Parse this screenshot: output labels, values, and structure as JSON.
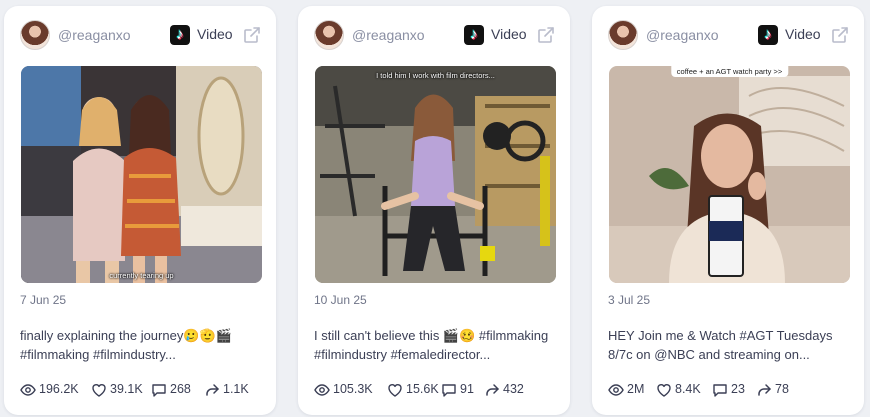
{
  "cards": [
    {
      "username": "@reaganxo",
      "post_type": "Video",
      "thumbnail_caption": "currently tearing up",
      "date": "7 Jun 25",
      "description_lines": [
        "finally explaining the journey🥲🫡🎬",
        "#filmmaking #filmindustry..."
      ],
      "views": "196.2K",
      "likes": "39.1K",
      "comments": "268",
      "shares": "1.1K"
    },
    {
      "username": "@reaganxo",
      "post_type": "Video",
      "thumbnail_caption": "I told him I work with film directors...",
      "date": "10 Jun 25",
      "description_lines": [
        "I still can't believe this 🎬🥴 #filmmaking",
        "#filmindustry #femaledirector..."
      ],
      "views": "105.3K",
      "likes": "15.6K",
      "comments": "91",
      "shares": "432"
    },
    {
      "username": "@reaganxo",
      "post_type": "Video",
      "thumbnail_caption": "coffee + an AGT watch party >>",
      "date": "3 Jul 25",
      "description_lines": [
        "HEY Join me & Watch #AGT Tuesdays",
        "8/7c on @NBC and streaming on..."
      ],
      "views": "2M",
      "likes": "8.4K",
      "comments": "23",
      "shares": "78"
    }
  ],
  "icons": {
    "platform": "tiktok-icon",
    "external_link": "external-link-icon",
    "views": "eye-icon",
    "likes": "heart-icon",
    "comments": "comment-icon",
    "shares": "share-icon"
  },
  "colors": {
    "background": "#eef0f4",
    "card": "#ffffff",
    "muted_text": "#8a8fa3",
    "text": "#3b3f55"
  }
}
